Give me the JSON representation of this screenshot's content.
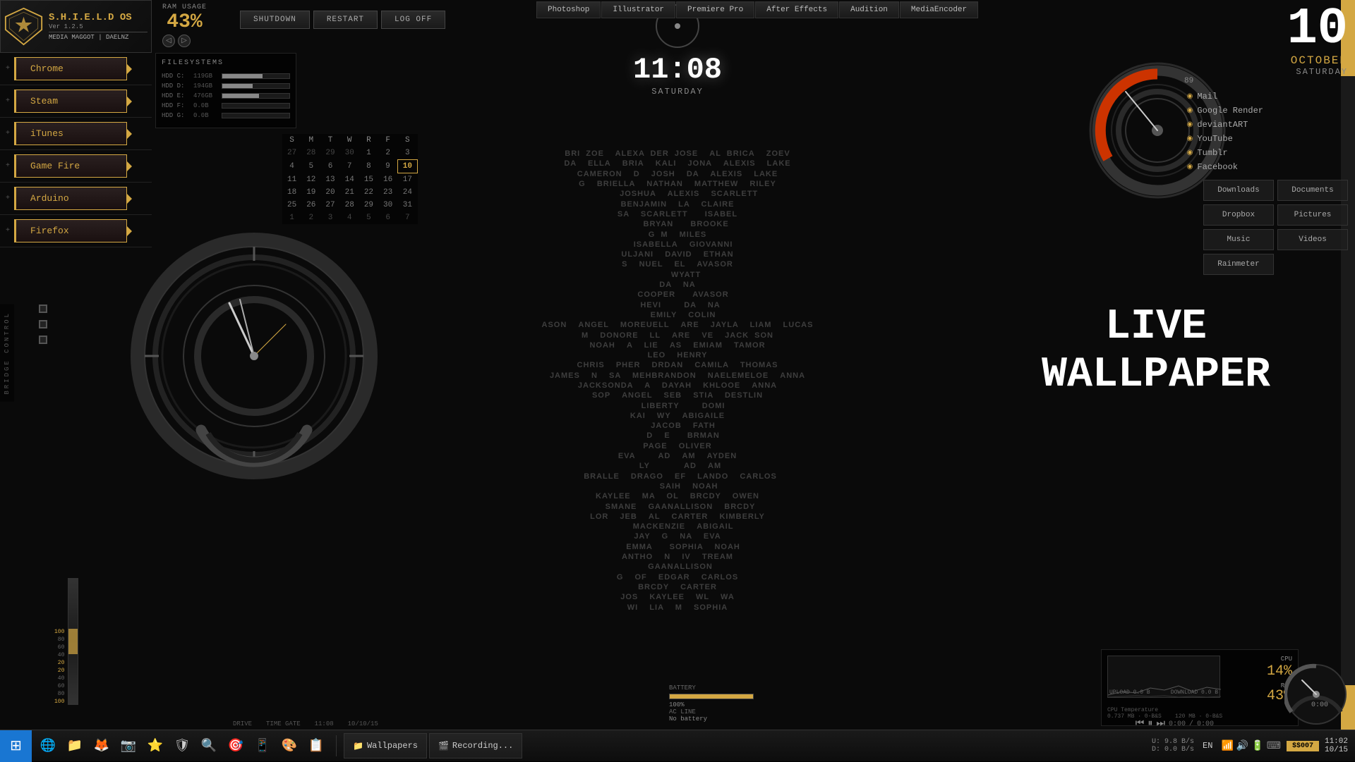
{
  "os": {
    "name": "S.H.I.E.L.D OS",
    "version": "Ver 1.2.5",
    "user1": "MEDIA MAGGOT",
    "user2": "DAELNZ"
  },
  "ram": {
    "label": "RAM USAGE",
    "value": "43%"
  },
  "action_buttons": {
    "shutdown": "SHUTDOWN",
    "restart": "RESTART",
    "logoff": "LOG OFF"
  },
  "clock": {
    "time": "11:08",
    "day": "Saturday"
  },
  "date": {
    "day_num": "10",
    "month": "OCTOBER",
    "weekday": "SATURDAY"
  },
  "top_shortcuts": [
    "Photoshop",
    "Illustrator",
    "Premiere Pro",
    "After Effects",
    "Audition",
    "MediaEncoder"
  ],
  "sidebar": {
    "items": [
      {
        "label": "Chrome"
      },
      {
        "label": "Steam"
      },
      {
        "label": "iTunes"
      },
      {
        "label": "Game Fire"
      },
      {
        "label": "Arduino"
      },
      {
        "label": "Firefox"
      }
    ]
  },
  "filesystems": {
    "title": "FILESYSTEMS",
    "items": [
      {
        "label": "HDD C:",
        "size": "119GB",
        "fill": 60
      },
      {
        "label": "HDD D:",
        "size": "194GB",
        "fill": 45
      },
      {
        "label": "HDD E:",
        "size": "476GB",
        "fill": 55
      },
      {
        "label": "HDD F:",
        "size": "0.0B",
        "fill": 0
      },
      {
        "label": "HDD G:",
        "size": "0.0B",
        "fill": 0
      }
    ]
  },
  "calendar": {
    "headers": [
      "S",
      "M",
      "T",
      "W",
      "R",
      "F",
      "S"
    ],
    "weeks": [
      [
        "27",
        "28",
        "29",
        "30",
        "1",
        "2",
        "3"
      ],
      [
        "4",
        "5",
        "6",
        "7",
        "8",
        "9",
        "10"
      ],
      [
        "11",
        "12",
        "13",
        "14",
        "15",
        "16",
        "17"
      ],
      [
        "18",
        "19",
        "20",
        "21",
        "22",
        "23",
        "24"
      ],
      [
        "25",
        "26",
        "27",
        "28",
        "29",
        "30",
        "31"
      ],
      [
        "1",
        "2",
        "3",
        "4",
        "5",
        "6",
        "7"
      ]
    ],
    "today": "10",
    "today_row": 1,
    "today_col": 6
  },
  "right_links": [
    "Mail",
    "Google Render",
    "deviantART",
    "YouTube",
    "Tumblr",
    "Facebook"
  ],
  "folder_shortcuts": [
    {
      "label": "Downloads",
      "wide": false
    },
    {
      "label": "Documents",
      "wide": false
    },
    {
      "label": "Dropbox",
      "wide": false
    },
    {
      "label": "Pictures",
      "wide": false
    },
    {
      "label": "Music",
      "wide": false
    },
    {
      "label": "Videos",
      "wide": false
    },
    {
      "label": "Rainmeter",
      "wide": false
    }
  ],
  "live_wallpaper": {
    "line1": "LIVE",
    "line2": "WALLPAPER"
  },
  "system_stats": {
    "cpu_label": "CPU",
    "cpu_value": "14%",
    "ram_label": "RAM",
    "ram_value": "43%",
    "upload_label": "UPLOAD",
    "upload_value": "0.0 B",
    "download_label": "DOWNLOAD",
    "download_value": "0.0 B",
    "temp_label": "CPU Temperature",
    "network_label": "0.737 MB",
    "network_value2": "120 MB"
  },
  "media_player": {
    "time_current": "0:00",
    "time_total": "0:00"
  },
  "battery": {
    "label": "BATTERY",
    "value": "100%",
    "ac_label": "AC LINE",
    "ac_value": "No battery"
  },
  "taskbar": {
    "start_icon": "⊞",
    "icons": [
      "🌐",
      "📁",
      "🦊",
      "📷",
      "⭐",
      "🛡",
      "🔍",
      "🎯",
      "📱",
      "🎨",
      "📋"
    ],
    "open_apps": [
      {
        "label": "Wallpapers",
        "icon": "📁"
      },
      {
        "label": "Recording...",
        "icon": "🎬"
      }
    ],
    "lang": "EN",
    "time": "11:02",
    "date_short": "10/15",
    "network_up": "U: 9.8 B/s",
    "network_down": "D: 0.0 B/s",
    "badge": "$$007"
  },
  "bridge_control": "BRIDGE CONTROL",
  "level_bars": {
    "labels": [
      "100",
      "80",
      "60",
      "40",
      "20",
      "20",
      "40",
      "60",
      "80",
      "100"
    ]
  }
}
